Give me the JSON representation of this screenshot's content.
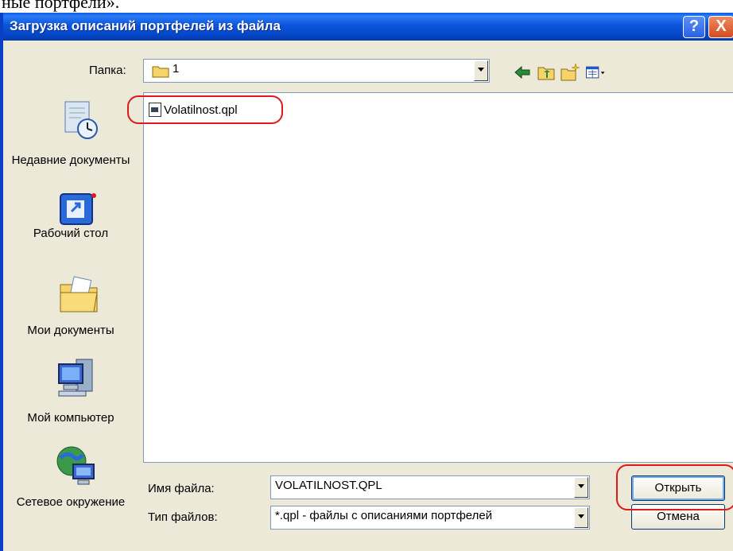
{
  "top_text": "ные портфели».",
  "window": {
    "title": "Загрузка описаний портфелей из файла",
    "help_label": "?",
    "close_label": "X"
  },
  "folder": {
    "label": "Папка:",
    "value": "1"
  },
  "toolbar": {
    "icons": [
      "back-arrow-icon",
      "up-folder-icon",
      "new-folder-icon",
      "view-menu-icon"
    ]
  },
  "places": [
    {
      "label": "Недавние документы",
      "icon": "recent-documents-icon"
    },
    {
      "label": "Рабочий стол",
      "icon": "desktop-icon"
    },
    {
      "label": "Мои документы",
      "icon": "my-documents-icon"
    },
    {
      "label": "Мой компьютер",
      "icon": "my-computer-icon"
    },
    {
      "label": "Сетевое окружение",
      "icon": "network-icon"
    }
  ],
  "files": [
    {
      "name": "Volatilnost.qpl"
    }
  ],
  "filename": {
    "label": "Имя файла:",
    "value": "VOLATILNOST.QPL"
  },
  "filetype": {
    "label": "Тип файлов:",
    "value": "*.qpl - файлы с описаниями портфелей"
  },
  "buttons": {
    "open": "Открыть",
    "cancel": "Отмена"
  },
  "colors": {
    "title_bar": "#0a55dc",
    "highlight_ring": "#e0191c",
    "dialog_bg": "#ece9d8"
  }
}
